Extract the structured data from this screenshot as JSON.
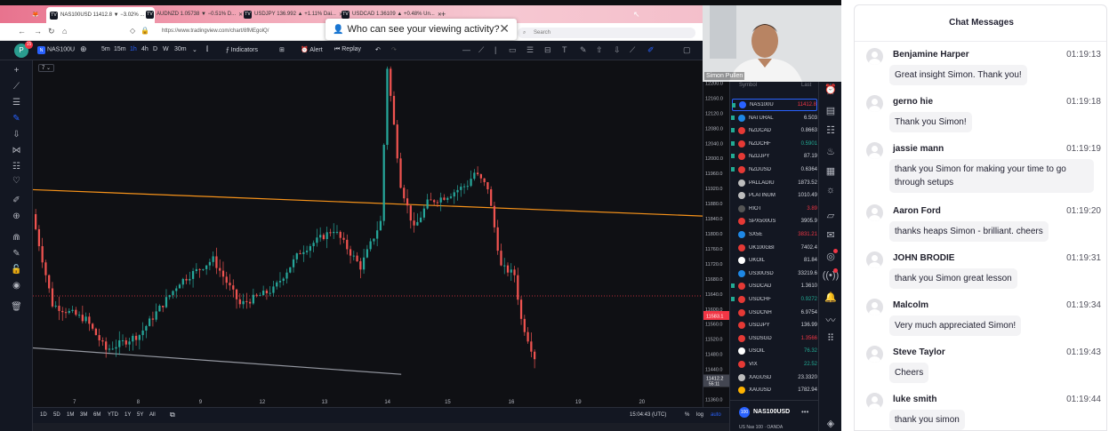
{
  "browser": {
    "tabs": [
      {
        "label": "NAS100USD 11412.8 ▼ −3.02% ..."
      },
      {
        "label": "AUDNZD 1.05738 ▼ −0.51% D..."
      },
      {
        "label": "USDJPY 136.992 ▲ +1.11% Dai..."
      },
      {
        "label": "USDCAD 1.36109 ▲ +0.48% Un..."
      }
    ],
    "new_tab": "+",
    "url": "https://www.tradingview.com/chart/8fMEgolQ/",
    "search_placeholder": "Search",
    "popup_text": "Who can see your viewing activity?",
    "popup_close": "✕"
  },
  "tv": {
    "avatar": "P",
    "badge": "15",
    "symbol": "NAS100U",
    "intervals": [
      "5m",
      "15m",
      "1h",
      "4h",
      "D",
      "W",
      "30m"
    ],
    "active_interval": "1h",
    "indicators": "Indicators",
    "alert": "Alert",
    "replay": "Replay",
    "collapse": "7",
    "timeframes": [
      "1D",
      "5D",
      "1M",
      "3M",
      "6M",
      "YTD",
      "1Y",
      "5Y",
      "All"
    ],
    "clock": "15:04:43 (UTC)",
    "pct": "%",
    "log": "log",
    "auto": "auto"
  },
  "chart_data": {
    "type": "candlestick",
    "x_ticks": [
      "7",
      "8",
      "9",
      "12",
      "13",
      "14",
      "15",
      "16",
      "19",
      "20"
    ],
    "y_ticks": [
      12240,
      12200,
      12160,
      12120,
      12080,
      12040,
      12000,
      11960,
      11920,
      11880,
      11840,
      11800,
      11760,
      11720,
      11680,
      11640,
      11600,
      11560,
      11520,
      11480,
      11440,
      11400,
      11360
    ],
    "ylim": [
      11340,
      12260
    ],
    "current_price_label": "11583.1",
    "last_price_label": "11412.2",
    "last_price_sub": "55:11",
    "trendlines": [
      {
        "color": "#f7931a",
        "from": {
          "x": 0,
          "y": 11865
        },
        "to": {
          "x": 1,
          "y": 11795
        }
      },
      {
        "color": "#9598a1",
        "from": {
          "x": 0,
          "y": 11445
        },
        "to": {
          "x": 0.55,
          "y": 11375
        }
      }
    ],
    "candles": []
  },
  "watchlist": {
    "header_symbol": "Symbol",
    "header_last": "Last",
    "rows": [
      {
        "symbol": "NAS100U",
        "last": "11412.8",
        "color": "#2962ff",
        "trend": "dn",
        "selected": true
      },
      {
        "symbol": "NATURAL",
        "last": "6.503",
        "color": "#1e88e5",
        "trend": "",
        "selected": false
      },
      {
        "symbol": "NZDCAD",
        "last": "0.8663",
        "color": "#e53935",
        "trend": "",
        "selected": false
      },
      {
        "symbol": "NZDCHF",
        "last": "0.5901",
        "color": "#e53935",
        "trend": "up",
        "selected": false
      },
      {
        "symbol": "NZDJPY",
        "last": "87.19",
        "color": "#e53935",
        "trend": "",
        "selected": false
      },
      {
        "symbol": "NZDUSD",
        "last": "0.6364",
        "color": "#e53935",
        "trend": "",
        "selected": false
      },
      {
        "symbol": "PALLADIU",
        "last": "1873.52",
        "color": "#bdbdbd",
        "trend": "",
        "selected": false
      },
      {
        "symbol": "PLATINUM",
        "last": "1010.49",
        "color": "#bdbdbd",
        "trend": "",
        "selected": false
      },
      {
        "symbol": "RIOT",
        "last": "3.89",
        "color": "#555555",
        "trend": "dn",
        "selected": false
      },
      {
        "symbol": "SPX500US",
        "last": "3905.9",
        "color": "#e53935",
        "trend": "",
        "selected": false
      },
      {
        "symbol": "SX5E",
        "last": "3831.21",
        "color": "#1e88e5",
        "trend": "dn",
        "selected": false
      },
      {
        "symbol": "UK100GBI",
        "last": "7402.4",
        "color": "#e53935",
        "trend": "",
        "selected": false
      },
      {
        "symbol": "UKOIL",
        "last": "81.84",
        "color": "#ffffff",
        "trend": "",
        "selected": false
      },
      {
        "symbol": "US30USD",
        "last": "33219.6",
        "color": "#1e88e5",
        "trend": "",
        "selected": false
      },
      {
        "symbol": "USDCAD",
        "last": "1.3610",
        "color": "#e53935",
        "trend": "",
        "selected": false
      },
      {
        "symbol": "USDCHF",
        "last": "0.9272",
        "color": "#e53935",
        "trend": "up",
        "selected": false
      },
      {
        "symbol": "USDCNH",
        "last": "6.9754",
        "color": "#e53935",
        "trend": "",
        "selected": false
      },
      {
        "symbol": "USDJPY",
        "last": "136.99",
        "color": "#e53935",
        "trend": "",
        "selected": false
      },
      {
        "symbol": "USDSGD",
        "last": "1.3566",
        "color": "#e53935",
        "trend": "dn",
        "selected": false
      },
      {
        "symbol": "USOIL",
        "last": "76.32",
        "color": "#ffffff",
        "trend": "up",
        "selected": false
      },
      {
        "symbol": "VIX",
        "last": "22.52",
        "color": "#e53935",
        "trend": "up",
        "selected": false
      },
      {
        "symbol": "XAGUSD",
        "last": "23.3320",
        "color": "#bdbdbd",
        "trend": "",
        "selected": false
      },
      {
        "symbol": "XAUUSD",
        "last": "1782.94",
        "color": "#ffb300",
        "trend": "",
        "selected": false
      }
    ],
    "detail_symbol": "NAS100USD",
    "detail_icon": "100",
    "detail_sub": "US Nas 100 · OANDA",
    "detail_more": "•••"
  },
  "webcam": {
    "name": "Simon Pullen"
  },
  "chat": {
    "title": "Chat Messages",
    "messages": [
      {
        "name": "Benjamine Harper",
        "time": "01:19:13",
        "text": "Great insight Simon. Thank you!"
      },
      {
        "name": "gerno hie",
        "time": "01:19:18",
        "text": "Thank you Simon!"
      },
      {
        "name": "jassie mann",
        "time": "01:19:19",
        "text": "thank you Simon for making your time to go through setups"
      },
      {
        "name": "Aaron Ford",
        "time": "01:19:20",
        "text": "thanks heaps Simon - brilliant. cheers"
      },
      {
        "name": "JOHN BRODIE",
        "time": "01:19:31",
        "text": "thank you Simon great lesson"
      },
      {
        "name": "Malcolm",
        "time": "01:19:34",
        "text": "Very much appreciated Simon!"
      },
      {
        "name": "Steve Taylor",
        "time": "01:19:43",
        "text": "Cheers"
      },
      {
        "name": "luke smith",
        "time": "01:19:44",
        "text": "thank you simon"
      }
    ]
  }
}
